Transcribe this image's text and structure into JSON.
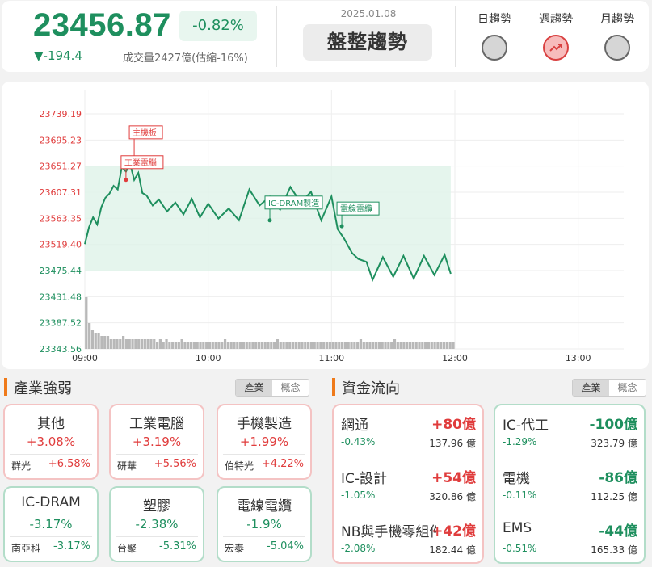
{
  "header": {
    "index_value": "23456.87",
    "change_pct": "-0.82%",
    "change_pts": "▼-194.4",
    "volume": "成交量2427億(估縮-16%)",
    "date": "2025.01.08",
    "trend_label": "盤整趨勢",
    "trend_buttons": [
      {
        "label": "日趨勢",
        "icon": "circle-icon",
        "active": false
      },
      {
        "label": "週趨勢",
        "icon": "trend-up-icon",
        "active": true
      },
      {
        "label": "月趨勢",
        "icon": "circle-icon",
        "active": false
      }
    ]
  },
  "chart_data": {
    "type": "line",
    "y_ticks": [
      "23739.19",
      "23695.23",
      "23651.27",
      "23607.31",
      "23563.35",
      "23519.40",
      "23475.44",
      "23431.48",
      "23387.52",
      "23343.56"
    ],
    "y_tick_colors": [
      "#e03c3c",
      "#e03c3c",
      "#e03c3c",
      "#e03c3c",
      "#e03c3c",
      "#e03c3c",
      "#1e8f5e",
      "#1e8f5e",
      "#1e8f5e",
      "#1e8f5e"
    ],
    "ylim": [
      23343.56,
      23739.19
    ],
    "x_ticks": [
      "09:00",
      "10:00",
      "11:00",
      "12:00",
      "13:00"
    ],
    "x_start": "09:00",
    "x_end": "13:30",
    "line_color": "#1e8f5e",
    "range_band": [
      23475.44,
      23651.27
    ],
    "series": [
      {
        "values": [
          {
            "t": "09:00",
            "v": 23520
          },
          {
            "t": "09:02",
            "v": 23548
          },
          {
            "t": "09:04",
            "v": 23565
          },
          {
            "t": "09:06",
            "v": 23553
          },
          {
            "t": "09:08",
            "v": 23582
          },
          {
            "t": "09:10",
            "v": 23598
          },
          {
            "t": "09:12",
            "v": 23605
          },
          {
            "t": "09:14",
            "v": 23618
          },
          {
            "t": "09:16",
            "v": 23612
          },
          {
            "t": "09:18",
            "v": 23650
          },
          {
            "t": "09:20",
            "v": 23642
          },
          {
            "t": "09:22",
            "v": 23655
          },
          {
            "t": "09:24",
            "v": 23628
          },
          {
            "t": "09:26",
            "v": 23640
          },
          {
            "t": "09:28",
            "v": 23606
          },
          {
            "t": "09:30",
            "v": 23602
          },
          {
            "t": "09:33",
            "v": 23585
          },
          {
            "t": "09:36",
            "v": 23595
          },
          {
            "t": "09:40",
            "v": 23575
          },
          {
            "t": "09:44",
            "v": 23590
          },
          {
            "t": "09:48",
            "v": 23570
          },
          {
            "t": "09:52",
            "v": 23596
          },
          {
            "t": "09:56",
            "v": 23565
          },
          {
            "t": "10:00",
            "v": 23588
          },
          {
            "t": "10:05",
            "v": 23563
          },
          {
            "t": "10:10",
            "v": 23580
          },
          {
            "t": "10:15",
            "v": 23560
          },
          {
            "t": "10:20",
            "v": 23612
          },
          {
            "t": "10:25",
            "v": 23585
          },
          {
            "t": "10:30",
            "v": 23600
          },
          {
            "t": "10:35",
            "v": 23578
          },
          {
            "t": "10:40",
            "v": 23616
          },
          {
            "t": "10:45",
            "v": 23590
          },
          {
            "t": "10:50",
            "v": 23608
          },
          {
            "t": "10:55",
            "v": 23560
          },
          {
            "t": "11:00",
            "v": 23600
          },
          {
            "t": "11:03",
            "v": 23545
          },
          {
            "t": "11:06",
            "v": 23530
          },
          {
            "t": "11:10",
            "v": 23505
          },
          {
            "t": "11:13",
            "v": 23495
          },
          {
            "t": "11:17",
            "v": 23490
          },
          {
            "t": "11:20",
            "v": 23460
          },
          {
            "t": "11:25",
            "v": 23498
          },
          {
            "t": "11:30",
            "v": 23465
          },
          {
            "t": "11:35",
            "v": 23500
          },
          {
            "t": "11:40",
            "v": 23462
          },
          {
            "t": "11:45",
            "v": 23500
          },
          {
            "t": "11:50",
            "v": 23468
          },
          {
            "t": "11:55",
            "v": 23502
          },
          {
            "t": "11:58",
            "v": 23470
          }
        ]
      }
    ],
    "volume_bars": [
      16,
      8,
      6,
      5,
      5,
      4,
      4,
      4,
      3,
      3,
      3,
      3,
      4,
      3,
      3,
      3,
      3,
      3,
      3,
      3,
      3,
      3,
      3,
      2,
      3,
      2,
      3,
      2,
      2,
      2,
      2,
      3,
      2,
      2,
      2,
      2,
      2,
      2,
      2,
      2,
      2,
      2,
      2,
      2,
      2,
      3,
      2,
      2,
      2,
      2,
      2,
      2,
      2,
      2,
      2,
      2,
      2,
      2,
      2,
      2,
      2,
      2,
      3,
      2,
      2,
      2,
      2,
      2,
      2,
      2,
      2,
      2,
      2,
      2,
      2,
      2,
      2,
      2,
      2,
      2,
      2,
      2,
      2,
      2,
      2,
      2,
      2,
      2,
      2,
      3,
      2,
      2,
      2,
      2,
      2,
      2,
      2,
      2,
      2,
      2,
      3,
      2,
      2,
      2,
      2,
      2,
      2,
      2,
      2,
      2,
      2,
      2,
      2,
      2,
      2,
      2,
      2,
      2,
      2,
      2
    ],
    "annotations": [
      {
        "label": "主機板",
        "t": "09:24",
        "v": 23651,
        "color": "#e03c3c"
      },
      {
        "label": "工業電腦",
        "t": "09:20",
        "v": 23628,
        "color": "#e03c3c"
      },
      {
        "label": "IC-DRAM製造",
        "t": "10:30",
        "v": 23560,
        "color": "#1e8f5e"
      },
      {
        "label": "電線電纜",
        "t": "11:05",
        "v": 23550,
        "color": "#1e8f5e"
      }
    ]
  },
  "industry": {
    "title": "產業強弱",
    "toggle": [
      "產業",
      "概念"
    ],
    "tiles": [
      {
        "name": "其他",
        "pct": "+3.08%",
        "stock": "群光",
        "stock_pct": "+6.58%",
        "up": true
      },
      {
        "name": "工業電腦",
        "pct": "+3.19%",
        "stock": "研華",
        "stock_pct": "+5.56%",
        "up": true
      },
      {
        "name": "手機製造",
        "pct": "+1.99%",
        "stock": "伯特光",
        "stock_pct": "+4.22%",
        "up": true
      },
      {
        "name": "IC-DRAM",
        "pct": "-3.17%",
        "stock": "南亞科",
        "stock_pct": "-3.17%",
        "up": false
      },
      {
        "name": "塑膠",
        "pct": "-2.38%",
        "stock": "台聚",
        "stock_pct": "-5.31%",
        "up": false
      },
      {
        "name": "電線電纜",
        "pct": "-1.9%",
        "stock": "宏泰",
        "stock_pct": "-5.04%",
        "up": false
      }
    ]
  },
  "fund_flow": {
    "title": "資金流向",
    "toggle": [
      "產業",
      "概念"
    ],
    "inflow": [
      {
        "name": "網通",
        "amount": "+80億",
        "pct": "-0.43%",
        "total": "137.96 億"
      },
      {
        "name": "IC-設計",
        "amount": "+54億",
        "pct": "-1.05%",
        "total": "320.86 億"
      },
      {
        "name": "NB與手機零組件",
        "amount": "+42億",
        "pct": "-2.08%",
        "total": "182.44 億"
      }
    ],
    "outflow": [
      {
        "name": "IC-代工",
        "amount": "-100億",
        "pct": "-1.29%",
        "total": "323.79 億"
      },
      {
        "name": "電機",
        "amount": "-86億",
        "pct": "-0.11%",
        "total": "112.25 億"
      },
      {
        "name": "EMS",
        "amount": "-44億",
        "pct": "-0.51%",
        "total": "165.33 億"
      }
    ]
  }
}
